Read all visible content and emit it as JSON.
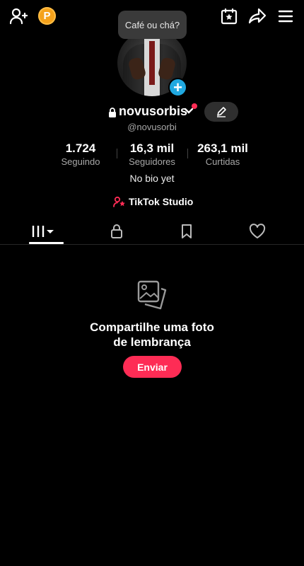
{
  "topbar": {
    "coin_letter": "P",
    "icons": [
      "add-user-icon",
      "coin-icon",
      "calendar-star-icon",
      "share-icon",
      "menu-icon"
    ]
  },
  "tooltip": {
    "text": "Café ou chá?"
  },
  "profile": {
    "username": "novusorbis",
    "handle": "@novusorbi",
    "bio": "No bio yet"
  },
  "stats": [
    {
      "value": "1.724",
      "label": "Seguindo"
    },
    {
      "value": "16,3 mil",
      "label": "Seguidores"
    },
    {
      "value": "263,1 mil",
      "label": "Curtidas"
    }
  ],
  "studio": {
    "label": "TikTok Studio"
  },
  "tabs": [
    "videos-grid-icon",
    "private-lock-icon",
    "bookmark-icon",
    "liked-heart-icon"
  ],
  "empty_state": {
    "title_line1": "Compartilhe uma foto",
    "title_line2": "de lembrança",
    "button_label": "Enviar"
  },
  "colors": {
    "accent": "#fe2c55",
    "coin": "#f5a21b",
    "plus_badge": "#20a8e0",
    "background": "#000000"
  }
}
